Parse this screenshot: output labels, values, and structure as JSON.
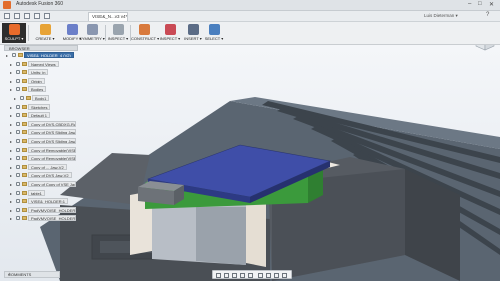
{
  "app": {
    "title": "Autodesk Fusion 360",
    "document_tab": "VISE&_N...v3 v4*",
    "user": "Luis Dieterman ▾"
  },
  "toolbar": {
    "items": [
      {
        "label": "SCULPT ▾",
        "icon": "sculpt-icon"
      },
      {
        "label": "CREATE ▾",
        "icon": "create-icon"
      },
      {
        "label": "MODIFY ▾",
        "icon": "modify-icon"
      },
      {
        "label": "SYMMETRY ▾",
        "icon": "symmetry-icon"
      },
      {
        "label": "INSPECT ▾",
        "icon": "inspect-icon"
      },
      {
        "label": "CONSTRUCT ▾",
        "icon": "construct-icon"
      },
      {
        "label": "INSPECT ▾",
        "icon": "inspect-icon"
      },
      {
        "label": "INSERT ▾",
        "icon": "insert-icon"
      },
      {
        "label": "SELECT ▾",
        "icon": "select-icon"
      }
    ]
  },
  "browser": {
    "header": "BROWSER",
    "rows": [
      {
        "label": "VISE&_HOLDER_4 (V2)",
        "level": 0,
        "selected": true
      },
      {
        "label": "Named Views",
        "level": 1
      },
      {
        "label": "Units: in",
        "level": 1
      },
      {
        "label": "Origin",
        "level": 1
      },
      {
        "label": "Bodies",
        "level": 1
      },
      {
        "label": "Body1",
        "level": 2
      },
      {
        "label": "Sketches",
        "level": 1
      },
      {
        "label": "Default 1",
        "level": 1
      },
      {
        "label": "Copy of DVS-CBDXG-Rail",
        "level": 1
      },
      {
        "label": "Copy of DVS Sliding Jaw-V...",
        "level": 1
      },
      {
        "label": "Copy of DVS Sliding Jaw-V...",
        "level": 1
      },
      {
        "label": "Copy of Removable(VISE)",
        "level": 1
      },
      {
        "label": "Copy of Removable(VISE)",
        "level": 1
      },
      {
        "label": "Copy of ... Jaw-V2",
        "level": 1
      },
      {
        "label": "Copy of DVS Jaw-V2",
        "level": 1
      },
      {
        "label": "Copy of Copy of VSE Jaw F",
        "level": 1
      },
      {
        "label": "table1",
        "level": 1
      },
      {
        "label": "VISE&_HOLDER:1",
        "level": 1
      },
      {
        "label": "PadVMVOISE_HOLDER:1",
        "level": 1
      },
      {
        "label": "PadVMVOISE_HOLDER:1",
        "level": 1
      }
    ]
  },
  "comments": {
    "label": "COMMENTS"
  },
  "colors": {
    "top_plate": "#3f4ea8",
    "green_block": "#3b9a3c",
    "vise_body": "#4d5257",
    "jaw_light": "#e9e3da",
    "table": "#55606d",
    "accent_selected": "#3a6ea8"
  }
}
